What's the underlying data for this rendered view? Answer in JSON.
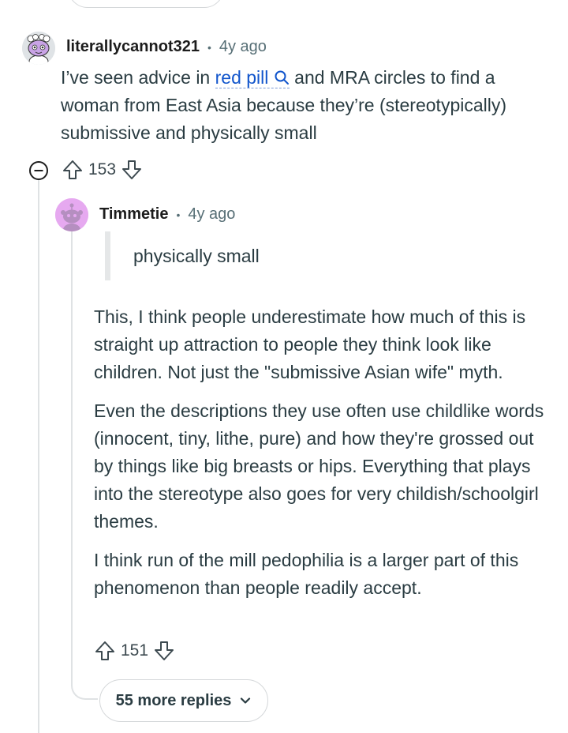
{
  "comment1": {
    "username": "literallycannot321",
    "separator": "•",
    "time": "4y ago",
    "text_before": "I’ve seen advice in ",
    "link_text": "red pill",
    "text_after": " and MRA circles to find a woman from East Asia because they’re (stereotypically) submissive and physically small",
    "votes": "153",
    "avatar_icon": "snoo-avatar-icon"
  },
  "comment2": {
    "username": "Timmetie",
    "separator": "•",
    "time": "4y ago",
    "quote": "physically small",
    "paragraphs": [
      "This, I think people underestimate how much of this is straight up attraction to people they think look like children. Not just the \"submissive Asian wife\" myth.",
      "Even the descriptions they use often use childlike words (innocent, tiny, lithe, pure) and how they're grossed out by things like big breasts or hips. Everything that plays into the stereotype also goes for very childish/schoolgirl themes.",
      "I think run of the mill pedophilia is a larger part of this phenomenon than people readily accept."
    ],
    "votes": "151",
    "avatar_icon": "snoo-avatar-icon"
  },
  "more_replies": {
    "label": "55 more replies"
  },
  "colors": {
    "link": "#1155cc",
    "meta": "#576f76",
    "text": "#2a3c42",
    "thread_line": "#dfe2e4",
    "avatar2_bg": "#e6a9f0"
  }
}
